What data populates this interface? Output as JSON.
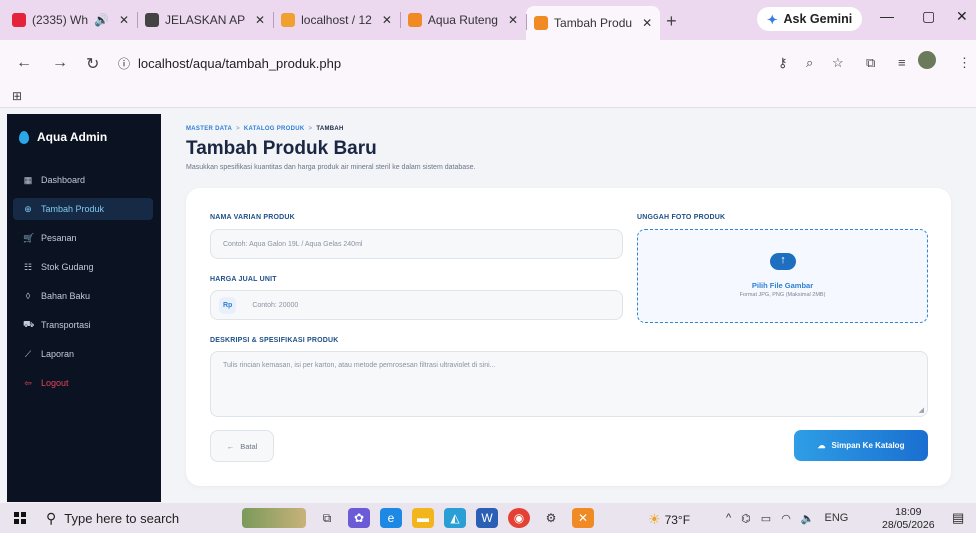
{
  "browser": {
    "tabs": [
      {
        "title": "(2335) Wh",
        "favicon_color": "#e3243b",
        "audio": "🔊"
      },
      {
        "title": "JELASKAN AP",
        "favicon_color": "#444444"
      },
      {
        "title": "localhost / 12",
        "favicon_color": "#f0a030"
      },
      {
        "title": "Aqua Ruteng",
        "favicon_color": "#f08a24"
      },
      {
        "title": "Tambah Produ",
        "favicon_color": "#f08a24",
        "active": true
      }
    ],
    "new_tab": "+",
    "gemini_label": "Ask Gemini",
    "url": "localhost/aqua/tambah_produk.php"
  },
  "sidebar": {
    "brand": "Aqua Admin",
    "items": [
      {
        "label": "Dashboard",
        "icon": "dashboard-icon",
        "glyph": "▦"
      },
      {
        "label": "Tambah Produk",
        "icon": "plus-circle-icon",
        "glyph": "⊕",
        "active": true
      },
      {
        "label": "Pesanan",
        "icon": "cart-icon",
        "glyph": "🛒"
      },
      {
        "label": "Stok Gudang",
        "icon": "boxes-icon",
        "glyph": "☷"
      },
      {
        "label": "Bahan Baku",
        "icon": "droplet-icon",
        "glyph": "◊"
      },
      {
        "label": "Transportasi",
        "icon": "truck-icon",
        "glyph": "⛟"
      },
      {
        "label": "Laporan",
        "icon": "chart-icon",
        "glyph": "⟋"
      },
      {
        "label": "Logout",
        "icon": "logout-icon",
        "glyph": "⇦",
        "danger": true
      }
    ]
  },
  "breadcrumb": {
    "root": "MASTER DATA",
    "section": "KATALOG PRODUK",
    "current": "TAMBAH",
    "separator": ">"
  },
  "page": {
    "title": "Tambah Produk Baru",
    "subtitle": "Masukkan spesifikasi kuantitas dan harga produk air mineral steril ke dalam sistem database."
  },
  "form": {
    "name_label": "NAMA VARIAN PRODUK",
    "name_placeholder": "Contoh: Aqua Galon 19L / Aqua Gelas 240ml",
    "price_label": "HARGA JUAL UNIT",
    "price_prefix": "Rp",
    "price_placeholder": "Contoh: 20000",
    "upload_label": "UNGGAH FOTO PRODUK",
    "upload_title": "Pilih File Gambar",
    "upload_hint": "Format JPG, PNG (Maksimal 2MB)",
    "desc_label": "DESKRIPSI & SPESIFIKASI PRODUK",
    "desc_placeholder": "Tulis rincian kemasan, isi per karton, atau metode pemrosesan filtrasi ultraviolet di sini...",
    "back_label": "Batal",
    "save_label": "Simpan Ke Katalog"
  },
  "taskbar": {
    "search_placeholder": "Type here to search",
    "temperature": "73°F",
    "language": "ENG",
    "time": "18:09",
    "date": "28/05/2026"
  },
  "colors": {
    "accent": "#2f7fd3",
    "sidebar_bg": "#0b1222",
    "danger": "#e0435a"
  }
}
